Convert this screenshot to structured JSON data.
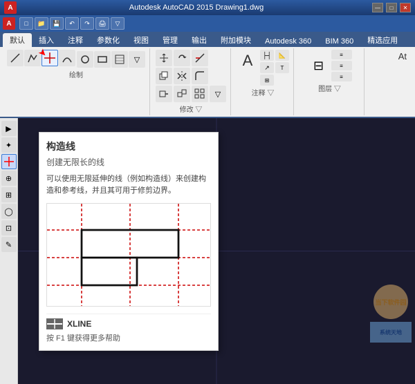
{
  "titlebar": {
    "logo": "A",
    "title": "Autodesk AutoCAD 2015    Drawing1.dwg",
    "controls": [
      "—",
      "□",
      "✕"
    ]
  },
  "quicktoolbar": {
    "buttons": [
      "▶",
      "↶",
      "↷",
      "□",
      "▽"
    ]
  },
  "menubar": {
    "items": [
      "默认",
      "插入",
      "注释",
      "参数化",
      "视图",
      "管理",
      "输出",
      "附加模块",
      "Autodesk 360",
      "BIM 360",
      "精选应用"
    ]
  },
  "ribbon": {
    "panels": [
      {
        "name": "draw-panel",
        "label": "绘制",
        "icons": [
          "直线",
          "多段线",
          "圆",
          "圆弧"
        ]
      },
      {
        "name": "modify-panel",
        "label": "修改",
        "icons": [
          "移动",
          "旋转",
          "修剪",
          "复制",
          "镜像",
          "圆角",
          "拉伸",
          "缩放",
          "阵列"
        ]
      },
      {
        "name": "text-panel",
        "label": "注释",
        "icons": [
          "文字",
          "引线",
          "表格"
        ]
      },
      {
        "name": "layers-panel",
        "label": "图层",
        "icons": [
          "图层特性"
        ]
      }
    ],
    "at_label": "At"
  },
  "tooltip": {
    "title": "构造线",
    "subtitle": "创建无限长的线",
    "description": "可以使用无限延伸的线（例如构造线）来创建构造和参考线，并且其可用于修剪边界。",
    "command_icon": "▬",
    "command": "XLINE",
    "help_text": "按 F1 键获得更多帮助"
  },
  "watermarks": {
    "right_top": "当下软件园",
    "right_bottom": "系统天地"
  },
  "left_toolbar": {
    "buttons": [
      "▶",
      "⊕",
      "✦",
      "↔",
      "⊞",
      "◯",
      "⊡",
      "✎"
    ]
  },
  "canvas": {
    "background": "#1a1a2e"
  }
}
